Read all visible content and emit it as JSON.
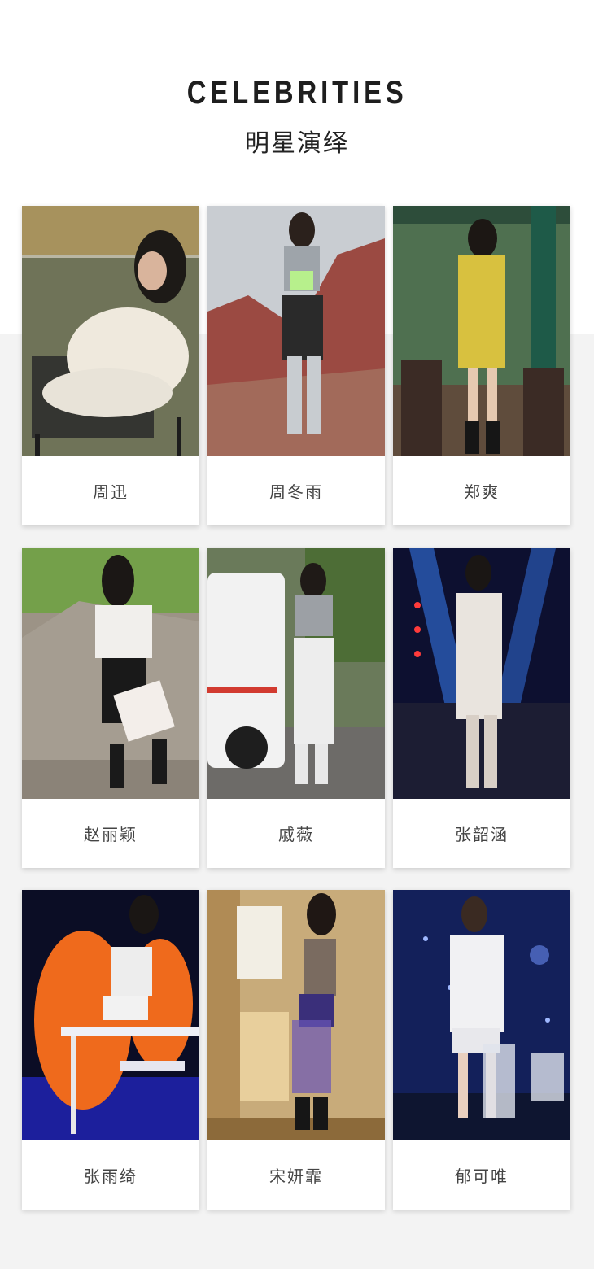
{
  "header": {
    "title_en": "CELEBRITIES",
    "title_cn": "明星演绎"
  },
  "celebrities": [
    {
      "name": "周迅"
    },
    {
      "name": "周冬雨"
    },
    {
      "name": "郑爽"
    },
    {
      "name": "赵丽颖"
    },
    {
      "name": "戚薇"
    },
    {
      "name": "张韶涵"
    },
    {
      "name": "张雨绮"
    },
    {
      "name": "宋妍霏"
    },
    {
      "name": "郁可唯"
    }
  ]
}
